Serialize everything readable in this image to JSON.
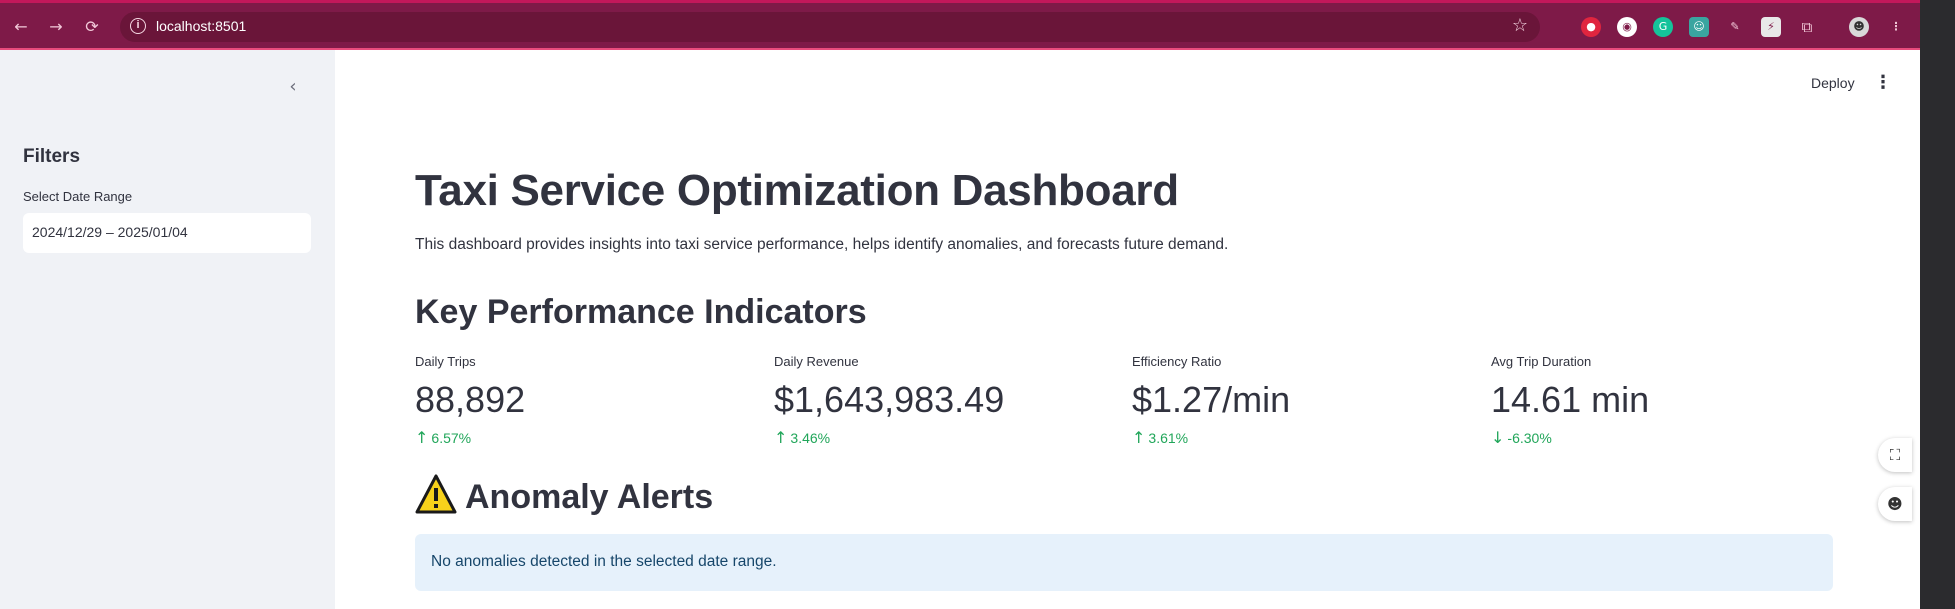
{
  "browser": {
    "url": "localhost:8501",
    "nav": {
      "back": "←",
      "forward": "→",
      "reload": "⟳"
    },
    "extensions": [
      "record-icon",
      "reader-icon",
      "grammarly-icon",
      "bot-icon",
      "pen-icon",
      "bolt-icon",
      "puzzle-icon"
    ]
  },
  "sidebar": {
    "collapse": "‹",
    "title": "Filters",
    "date_label": "Select Date Range",
    "date_value": "2024/12/29 – 2025/01/04"
  },
  "header": {
    "deploy": "Deploy",
    "menu": "⋮"
  },
  "main": {
    "title": "Taxi Service Optimization Dashboard",
    "subtitle": "This dashboard provides insights into taxi service performance, helps identify anomalies, and forecasts future demand.",
    "kpi_heading": "Key Performance Indicators",
    "kpis": [
      {
        "label": "Daily Trips",
        "value": "88,892",
        "delta": "6.57%",
        "direction": "up"
      },
      {
        "label": "Daily Revenue",
        "value": "$1,643,983.49",
        "delta": "3.46%",
        "direction": "up"
      },
      {
        "label": "Efficiency Ratio",
        "value": "$1.27/min",
        "delta": "3.61%",
        "direction": "up"
      },
      {
        "label": "Avg Trip Duration",
        "value": "14.61 min",
        "delta": "-6.30%",
        "direction": "down"
      }
    ],
    "alerts_heading": "Anomaly Alerts",
    "alerts_message": "No anomalies detected in the selected date range."
  },
  "colors": {
    "chrome": "#7e1a48",
    "delta_positive": "#21a65a",
    "info_bg": "#e6f1fb",
    "info_text": "#16466a"
  }
}
